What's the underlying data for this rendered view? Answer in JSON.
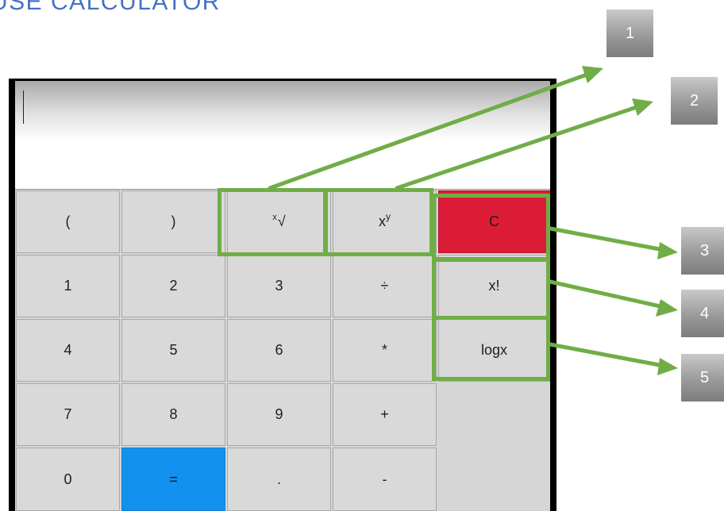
{
  "header": {
    "title": "USE CALCULATOR"
  },
  "display": {
    "value": ""
  },
  "keys": {
    "open_paren": "(",
    "close_paren": ")",
    "root_base": "x",
    "root_symbol": "√",
    "power_base": "x",
    "power_exp": "y",
    "clear": "C",
    "one": "1",
    "two": "2",
    "three": "3",
    "divide": "÷",
    "factorial": "x!",
    "four": "4",
    "five": "5",
    "six": "6",
    "multiply": "*",
    "log": "logx",
    "seven": "7",
    "eight": "8",
    "nine": "9",
    "plus": "+",
    "zero": "0",
    "equals": "=",
    "decimal": ".",
    "minus": "-"
  },
  "callouts": [
    "1",
    "2",
    "3",
    "4",
    "5"
  ],
  "colors": {
    "clear_key": "#dc1c36",
    "equals_key": "#1391ee",
    "highlight": "#70ad47",
    "title": "#4472c4"
  }
}
